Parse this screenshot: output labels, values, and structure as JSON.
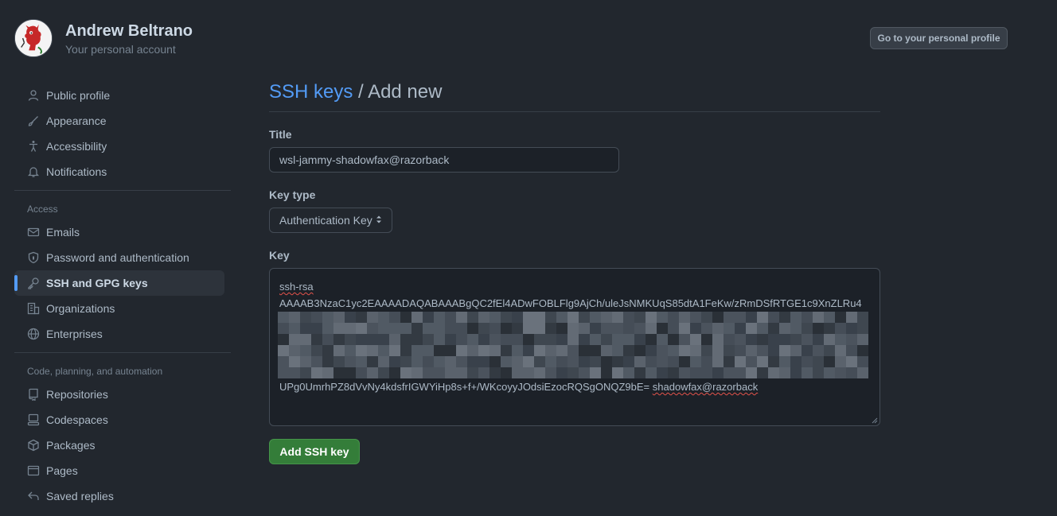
{
  "user": {
    "name": "Andrew Beltrano",
    "subtitle": "Your personal account",
    "profile_button": "Go to your personal profile"
  },
  "sidebar": {
    "items": [
      {
        "label": "Public profile",
        "icon": "person-icon"
      },
      {
        "label": "Appearance",
        "icon": "paintbrush-icon"
      },
      {
        "label": "Accessibility",
        "icon": "accessibility-icon"
      },
      {
        "label": "Notifications",
        "icon": "bell-icon"
      }
    ],
    "access_label": "Access",
    "access_items": [
      {
        "label": "Emails",
        "icon": "mail-icon"
      },
      {
        "label": "Password and authentication",
        "icon": "shield-lock-icon"
      },
      {
        "label": "SSH and GPG keys",
        "icon": "key-icon",
        "active": true
      },
      {
        "label": "Organizations",
        "icon": "organization-icon"
      },
      {
        "label": "Enterprises",
        "icon": "globe-icon"
      }
    ],
    "code_label": "Code, planning, and automation",
    "code_items": [
      {
        "label": "Repositories",
        "icon": "repo-icon"
      },
      {
        "label": "Codespaces",
        "icon": "codespaces-icon"
      },
      {
        "label": "Packages",
        "icon": "package-icon"
      },
      {
        "label": "Pages",
        "icon": "browser-icon"
      },
      {
        "label": "Saved replies",
        "icon": "reply-icon"
      }
    ]
  },
  "main": {
    "breadcrumb": "SSH keys",
    "separator": " / ",
    "title": "Add new",
    "title_label": "Title",
    "title_value": "wsl-jammy-shadowfax@razorback",
    "key_type_label": "Key type",
    "key_type_value": "Authentication Key",
    "key_label": "Key",
    "key_line1": "ssh-rsa",
    "key_line2": "AAAAB3NzaC1yc2EAAAADAQABAAABgQC2fEl4ADwFOBLFlg9AjCh/uleJsNMKUqS85dtA1FeKw/zRmDSfRTGE1c9XnZLRu4",
    "key_line_last": "UPg0UmrhPZ8dVvNy4kdsfrIGWYiHp8s+f+/WKcoyyJOdsiEzocRQSgONQZ9bE=",
    "key_comment": "shadowfax@razorback",
    "submit": "Add SSH key"
  },
  "colors": {
    "background": "#22272e",
    "accent": "#539bf5",
    "primary_button": "#347d39"
  }
}
